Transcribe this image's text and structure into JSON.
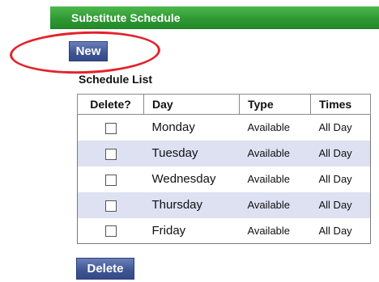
{
  "header": {
    "title": "Substitute Schedule"
  },
  "toolbar": {
    "new_label": "New"
  },
  "schedule_list": {
    "heading": "Schedule List",
    "columns": [
      "Delete?",
      "Day",
      "Type",
      "Times"
    ],
    "rows": [
      {
        "day": "Monday",
        "type": "Available",
        "times": "All Day",
        "checked": false
      },
      {
        "day": "Tuesday",
        "type": "Available",
        "times": "All Day",
        "checked": false
      },
      {
        "day": "Wednesday",
        "type": "Available",
        "times": "All Day",
        "checked": false
      },
      {
        "day": "Thursday",
        "type": "Available",
        "times": "All Day",
        "checked": false
      },
      {
        "day": "Friday",
        "type": "Available",
        "times": "All Day",
        "checked": false
      }
    ]
  },
  "footer": {
    "delete_label": "Delete"
  },
  "colors": {
    "header_green": "#2f9a34",
    "button_blue": "#3e5592",
    "row_alt": "#dde1f2",
    "annotation_red": "#e3232a"
  }
}
